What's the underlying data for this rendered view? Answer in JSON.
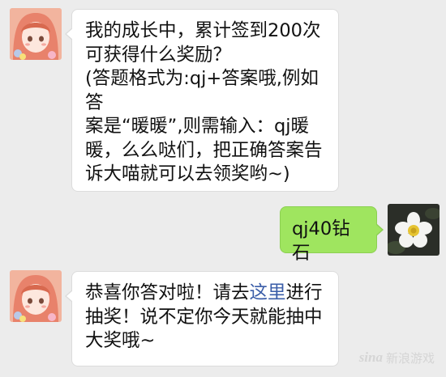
{
  "messages": [
    {
      "side": "left",
      "text": "我的成长中，累计签到200次\n可获得什么奖励？\n(答题格式为:qj+答案哦,例如答\n案是“暖暖”,则需输入：qj暖\n暖，么么哒们，把正确答案告\n诉大喵就可以去领奖哟~)"
    },
    {
      "side": "right",
      "text": "qj40钻石"
    },
    {
      "side": "left",
      "text_before": "恭喜你答对啦！请去",
      "link_text": "这里",
      "text_after": "进行\n抽奖！说不定你今天就能抽中\n大奖哦~"
    }
  ],
  "watermark": {
    "logo_text": "sina",
    "label": "新浪游戏"
  },
  "colors": {
    "background": "#ececec",
    "bubble_left": "#ffffff",
    "bubble_right": "#9fe55f",
    "link": "#3a5da8"
  }
}
